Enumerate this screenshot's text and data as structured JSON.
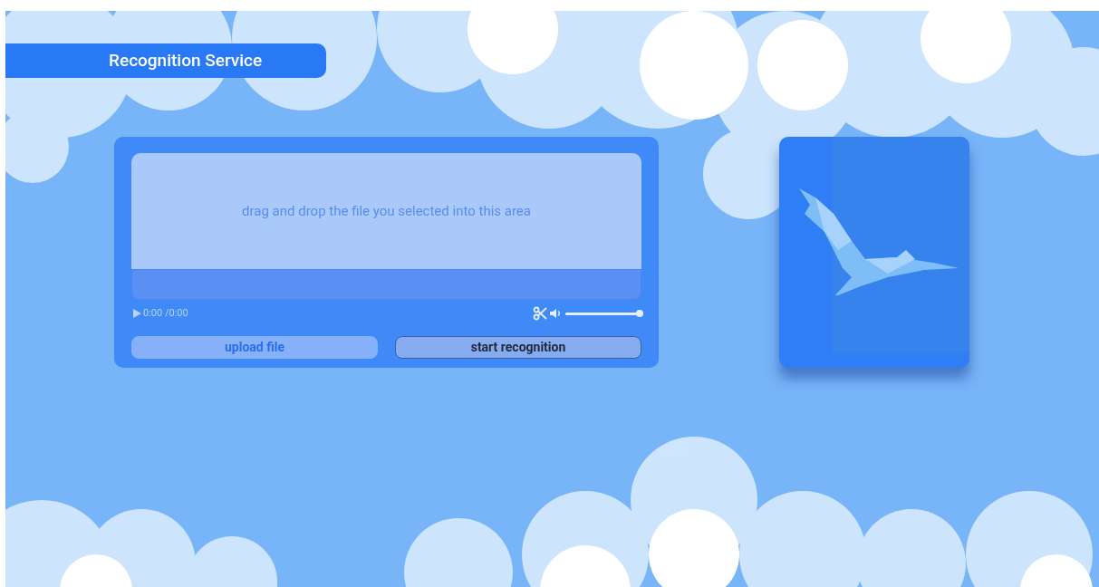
{
  "header": {
    "title": "Recognition Service"
  },
  "player": {
    "drop_hint": "drag and drop the file you selected into this area",
    "time": "0:00 /0:00",
    "volume": {
      "level": 1.0
    }
  },
  "buttons": [
    {
      "label": "upload file",
      "kind": "light"
    },
    {
      "label": "start recognition",
      "kind": "outlined"
    }
  ]
}
